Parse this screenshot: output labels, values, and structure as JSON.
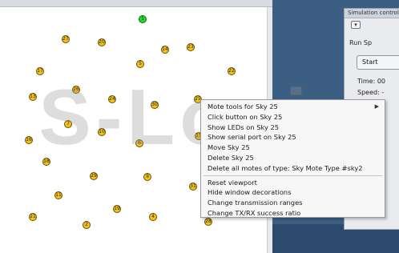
{
  "watermark": "S-Logix",
  "control_panel": {
    "title": "Simulation control",
    "close_glyph": "▾",
    "menu_text": "Run  Sp",
    "start_label": "Start",
    "time_label": "Time: 00",
    "speed_label": "Speed: -"
  },
  "motes": [
    {
      "id": "1",
      "color": "green"
    },
    {
      "id": "27",
      "color": "yellow"
    },
    {
      "id": "20",
      "color": "yellow"
    },
    {
      "id": "14",
      "color": "yellow"
    },
    {
      "id": "23",
      "color": "yellow"
    },
    {
      "id": "5",
      "color": "yellow"
    },
    {
      "id": "17",
      "color": "yellow"
    },
    {
      "id": "22",
      "color": "yellow"
    },
    {
      "id": "26",
      "color": "yellow"
    },
    {
      "id": "13",
      "color": "yellow"
    },
    {
      "id": "24",
      "color": "yellow"
    },
    {
      "id": "30",
      "color": "yellow"
    },
    {
      "id": "25",
      "color": "yellow"
    },
    {
      "id": "7",
      "color": "yellow"
    },
    {
      "id": "16",
      "color": "yellow"
    },
    {
      "id": "10",
      "color": "yellow"
    },
    {
      "id": "18",
      "color": "yellow"
    },
    {
      "id": "6",
      "color": "yellow"
    },
    {
      "id": "15",
      "color": "yellow"
    },
    {
      "id": "29",
      "color": "yellow"
    },
    {
      "id": "9",
      "color": "yellow"
    },
    {
      "id": "31",
      "color": "yellow"
    },
    {
      "id": "11",
      "color": "yellow"
    },
    {
      "id": "21",
      "color": "yellow"
    },
    {
      "id": "19",
      "color": "yellow"
    },
    {
      "id": "4",
      "color": "yellow"
    },
    {
      "id": "2",
      "color": "yellow"
    },
    {
      "id": "28",
      "color": "yellow"
    }
  ],
  "context_menu": {
    "items": [
      {
        "label": "Mote tools for Sky 25",
        "submenu": true
      },
      {
        "label": "Click button on Sky 25"
      },
      {
        "label": "Show LEDs on Sky 25"
      },
      {
        "label": "Show serial port on Sky 25"
      },
      {
        "label": "Move Sky 25"
      },
      {
        "label": "Delete Sky 25"
      },
      {
        "label": "Delete all motes of type: Sky Mote Type #sky2"
      },
      {
        "label": "Reset viewport"
      },
      {
        "label": "Hide window decorations"
      },
      {
        "label": "Change transmission ranges"
      },
      {
        "label": "Change TX/RX success ratio"
      }
    ],
    "submenu_glyph": "▶"
  },
  "colors": {
    "mote_yellow": "#f3c21a",
    "mote_green": "#1fdc2a",
    "desktop_blue": "#3d5e83"
  }
}
